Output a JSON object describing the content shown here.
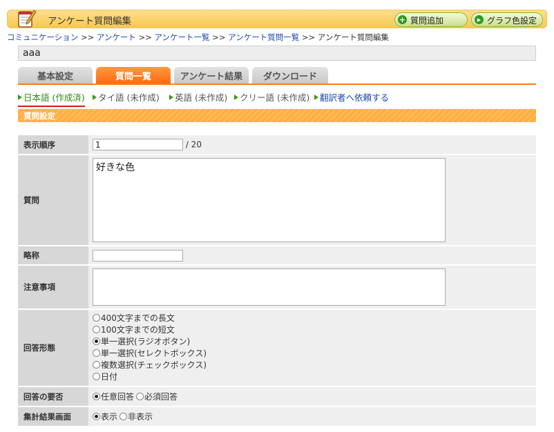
{
  "header": {
    "title": "アンケート質問編集",
    "icon": "notepad-pencil-icon",
    "add_question_label": "質問追加",
    "graph_color_label": "グラフ色設定"
  },
  "breadcrumb": {
    "items": [
      "コミュニケーション",
      "アンケート",
      "アンケート一覧",
      "アンケート質問一覧"
    ],
    "current": "アンケート質問編集",
    "separator": ">>"
  },
  "survey_name": "aaa",
  "tabs": [
    "基本設定",
    "質問一覧",
    "アンケート結果",
    "ダウンロード"
  ],
  "active_tab": "質問一覧",
  "languages": [
    {
      "label": "日本語 (作成済)",
      "current": true
    },
    {
      "label": "タイ語 (未作成)",
      "current": false
    },
    {
      "label": "英語 (未作成)",
      "current": false
    },
    {
      "label": "クリー語 (未作成)",
      "current": false
    }
  ],
  "translator_request": "翻訳者へ依頼する",
  "section_title": "質問設定",
  "form": {
    "order_label": "表示順序",
    "order_value": "1",
    "order_total": "/ 20",
    "question_label": "質問",
    "question_value": "好きな色",
    "abbrev_label": "略称",
    "abbrev_value": "",
    "notes_label": "注意事項",
    "notes_value": "",
    "answer_type_label": "回答形態",
    "answer_types": [
      {
        "label": "400文字までの長文",
        "selected": false
      },
      {
        "label": "100文字までの短文",
        "selected": false
      },
      {
        "label": "単一選択(ラジオボタン)",
        "selected": true
      },
      {
        "label": "単一選択(セレクトボックス)",
        "selected": false
      },
      {
        "label": "複数選択(チェックボックス)",
        "selected": false
      },
      {
        "label": "日付",
        "selected": false
      }
    ],
    "required_label": "回答の要否",
    "required_options": [
      {
        "label": "任意回答",
        "selected": true
      },
      {
        "label": "必須回答",
        "selected": false
      }
    ],
    "result_label": "集計結果画面",
    "result_options": [
      {
        "label": "表示",
        "selected": true
      },
      {
        "label": "非表示",
        "selected": false
      }
    ]
  },
  "colors": {
    "header_bg": "#f8c852",
    "tab_active": "#ff6a10",
    "lang_current": "#2e8a12",
    "link": "#1a48b0",
    "section_bar": "#ffad42"
  }
}
